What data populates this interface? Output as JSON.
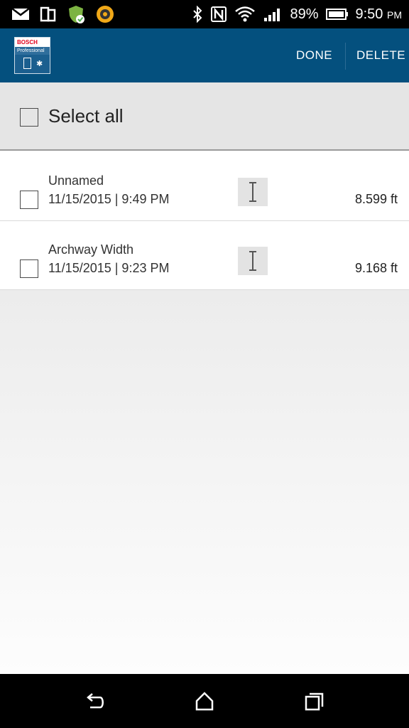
{
  "status_bar": {
    "battery": "89%",
    "time": "9:50",
    "ampm": "PM",
    "icons_left": [
      "mail-icon",
      "device-icon",
      "shield-check-icon",
      "app-circle-icon"
    ],
    "icons_right": [
      "bluetooth-icon",
      "nfc-icon",
      "wifi-icon",
      "signal-icon",
      "battery-icon"
    ]
  },
  "app_bar": {
    "logo": {
      "brand": "BOSCH",
      "sub": "Professional"
    },
    "done_label": "DONE",
    "delete_label": "DELETE",
    "color": "#04507e"
  },
  "select_all": {
    "label": "Select all"
  },
  "measurements": [
    {
      "name": "Unnamed",
      "date": "11/15/2015 | 9:49 PM",
      "value": "8.599 ft",
      "icon": "length-icon"
    },
    {
      "name": "Archway Width",
      "date": "11/15/2015 | 9:23 PM",
      "value": "9.168 ft",
      "icon": "length-icon"
    }
  ],
  "nav_bar": {
    "icons": [
      "back-icon",
      "home-icon",
      "recents-icon"
    ]
  }
}
